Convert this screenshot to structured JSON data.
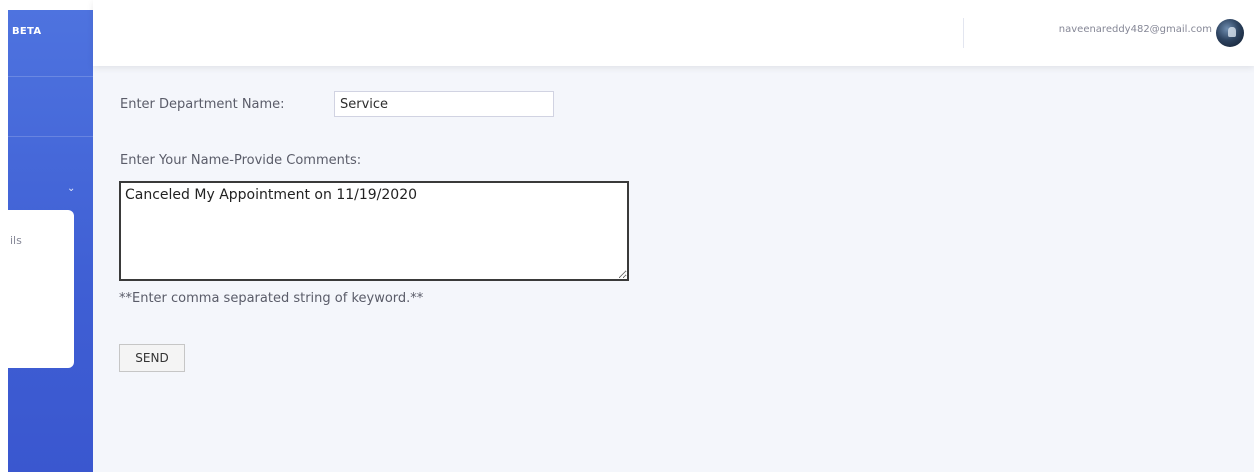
{
  "sidebar": {
    "brand_text": "BETA",
    "collapse_item_partial": "ils"
  },
  "topbar": {
    "user_email": "naveenareddy482@gmail.com"
  },
  "form": {
    "department_label": "Enter Department Name:",
    "department_value": "Service",
    "comments_label": "Enter Your Name-Provide Comments:",
    "comments_value": "Canceled My Appointment on 11/19/2020",
    "hint": "**Enter comma separated string of keyword.**",
    "send_label": "SEND"
  },
  "colors": {
    "sidebar": "#4e73df",
    "background": "#f4f6fb",
    "text": "#5a5c69"
  }
}
